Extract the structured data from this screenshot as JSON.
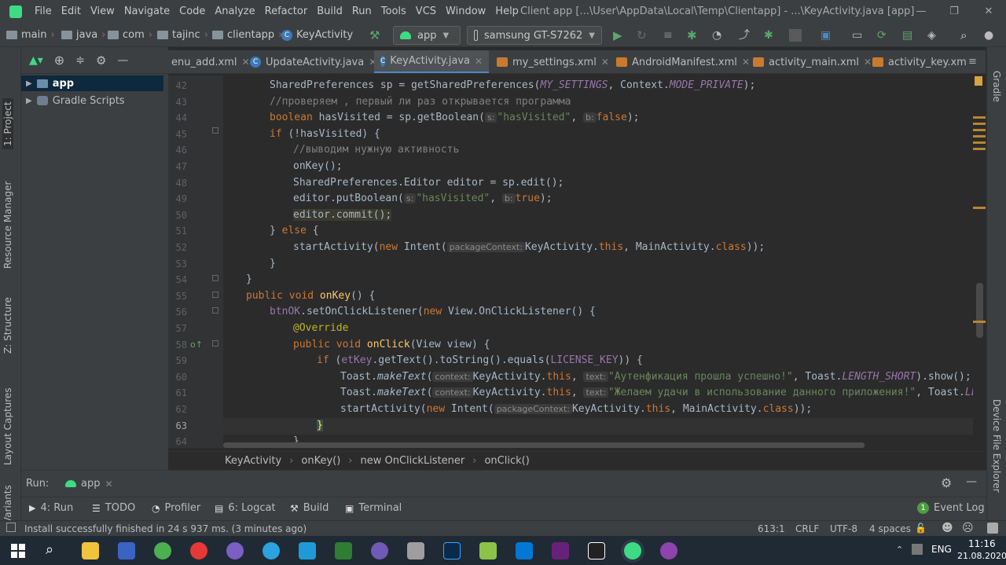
{
  "menubar": {
    "items": [
      "File",
      "Edit",
      "View",
      "Navigate",
      "Code",
      "Analyze",
      "Refactor",
      "Build",
      "Run",
      "Tools",
      "VCS",
      "Window",
      "Help"
    ],
    "title": "Client app [...\\User\\AppData\\Local\\Temp\\Clientapp] - ...\\KeyActivity.java [app]"
  },
  "navbar": {
    "breadcrumbs": [
      "main",
      "java",
      "com",
      "tajinc",
      "clientapp",
      "KeyActivity"
    ],
    "run_config": "app",
    "device": "samsung GT-S7262"
  },
  "left_strip": {
    "labels": [
      "1: Project",
      "Resource Manager",
      "Z: Structure",
      "Layout Captures",
      "Build Variants"
    ]
  },
  "project_tree": {
    "items": [
      {
        "label": "app",
        "selected": true
      },
      {
        "label": "Gradle Scripts",
        "selected": false
      }
    ]
  },
  "tabs": [
    {
      "label": "enu_add.xml",
      "type": "xml",
      "active": false
    },
    {
      "label": "UpdateActivity.java",
      "type": "java",
      "active": false
    },
    {
      "label": "KeyActivity.java",
      "type": "java",
      "active": true
    },
    {
      "label": "my_settings.xml",
      "type": "xml",
      "active": false
    },
    {
      "label": "AndroidManifest.xml",
      "type": "xml",
      "active": false
    },
    {
      "label": "activity_main.xml",
      "type": "xml",
      "active": false
    },
    {
      "label": "activity_key.xm",
      "type": "xml",
      "active": false
    }
  ],
  "code": {
    "line_numbers": [
      "42",
      "43",
      "44",
      "45",
      "46",
      "47",
      "48",
      "49",
      "50",
      "51",
      "52",
      "53",
      "54",
      "55",
      "56",
      "57",
      "58",
      "59",
      "60",
      "61",
      "62",
      "63",
      "64"
    ],
    "l42": {
      "a": "SharedPreferences sp = getSharedPreferences(",
      "b": "MY_SETTINGS",
      "c": ", Context.",
      "d": "MODE_PRIVATE",
      "e": ");"
    },
    "l43": "//проверяем , первый ли раз открывается программа",
    "l44": {
      "a": "boolean",
      "b": " hasVisited = sp.getBoolean(",
      "h1": "s:",
      "s": "\"hasVisited\"",
      "c": ", ",
      "h2": "b:",
      "d": "false",
      "e": ");"
    },
    "l45": {
      "a": "if",
      "b": " (!hasVisited) {"
    },
    "l46": "//выводим нужную активность",
    "l47": "onKey();",
    "l48": "SharedPreferences.Editor editor = sp.edit();",
    "l49": {
      "a": "editor.putBoolean(",
      "h1": "s:",
      "s": "\"hasVisited\"",
      "c": ", ",
      "h2": "b:",
      "d": "true",
      "e": ");"
    },
    "l50": "editor.commit();",
    "l51": {
      "a": "} ",
      "b": "else",
      "c": " {"
    },
    "l52": {
      "a": "startActivity(",
      "b": "new",
      "c": " Intent(",
      "h": "packageContext:",
      "d": "KeyActivity.",
      "e": "this",
      "f": ", MainActivity.",
      "g": "class",
      "i": "));"
    },
    "l53": "}",
    "l54": "}",
    "l55": {
      "a": "public void ",
      "b": "onKey",
      "c": "() {"
    },
    "l56": {
      "a": "btnOK",
      "b": ".setOnClickListener(",
      "c": "new",
      "d": " View.OnClickListener() {"
    },
    "l57": "@Override",
    "l58": {
      "a": "public void ",
      "b": "onClick",
      "c": "(View view) {"
    },
    "l59": {
      "a": "if",
      "b": " (",
      "c": "etKey",
      "d": ".getText().toString().equals(",
      "e": "LICENSE_KEY",
      "f": ")) {"
    },
    "l60": {
      "a": "Toast.",
      "b": "makeText",
      "c": "(",
      "h1": "context:",
      "d": "KeyActivity.",
      "e": "this",
      "f": ", ",
      "h2": "text:",
      "s": "\"Аутенфикация прошла успешно!\"",
      "g": ", Toast.",
      "k": "LENGTH_SHORT",
      "m": ").show();"
    },
    "l61": {
      "a": "Toast.",
      "b": "makeText",
      "c": "(",
      "h1": "context:",
      "d": "KeyActivity.",
      "e": "this",
      "f": ", ",
      "h2": "text:",
      "s": "\"Желаем удачи в использование данного приложения!\"",
      "g": ", Toast.",
      "k": "LENGTH_"
    },
    "l62": {
      "a": "startActivity(",
      "b": "new",
      "c": " Intent(",
      "h": "packageContext:",
      "d": "KeyActivity.",
      "e": "this",
      "f": ", MainActivity.",
      "g": "class",
      "i": "));"
    },
    "l63": "}",
    "l64": "}"
  },
  "crumbbar": [
    "KeyActivity",
    "onKey()",
    "new OnClickListener",
    "onClick()"
  ],
  "run_panel": {
    "label": "Run:",
    "config": "app"
  },
  "tool_tabs": [
    {
      "label": "4: Run"
    },
    {
      "label": "TODO"
    },
    {
      "label": "Profiler"
    },
    {
      "label": "6: Logcat"
    },
    {
      "label": "Build"
    },
    {
      "label": "Terminal"
    }
  ],
  "event_log": {
    "count": "1",
    "label": "Event Log"
  },
  "right_strip": {
    "labels": [
      "Gradle",
      "Device File Explorer"
    ]
  },
  "status": {
    "message": "Install successfully finished in 24 s 937 ms. (3 minutes ago)",
    "position": "613:1",
    "line_sep": "CRLF",
    "encoding": "UTF-8",
    "indent": "4 spaces"
  },
  "taskbar": {
    "lang": "ENG",
    "time": "11:16",
    "date": "21.08.2020"
  }
}
